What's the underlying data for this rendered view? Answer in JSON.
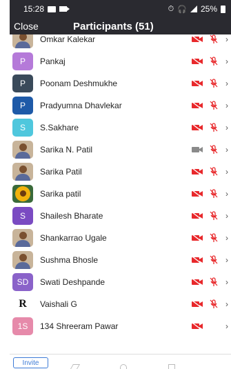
{
  "status_bar": {
    "time": "15:28",
    "battery": "25%"
  },
  "header": {
    "close_label": "Close",
    "title": "Participants (51)"
  },
  "colors": {
    "muted_red": "#e8282b",
    "header_bg": "#2a2a30",
    "video_on_grey": "#8a8a8a"
  },
  "participants": [
    {
      "name": "Omkar Kalekar",
      "avatar": "photo",
      "video": "off",
      "mic": "muted"
    },
    {
      "name": "Pankaj",
      "avatar": "P",
      "avatar_color": "#b57ad9",
      "video": "off",
      "mic": "muted"
    },
    {
      "name": "Poonam Deshmukhe",
      "avatar": "P",
      "avatar_color": "#3a4a5a",
      "video": "off",
      "mic": "muted"
    },
    {
      "name": "Pradyumna Dhavlekar",
      "avatar": "P",
      "avatar_color": "#1e5aa8",
      "video": "off",
      "mic": "muted"
    },
    {
      "name": "S.Sakhare",
      "avatar": "S",
      "avatar_color": "#4fc7dd",
      "video": "off",
      "mic": "muted"
    },
    {
      "name": "Sarika N. Patil",
      "avatar": "photo",
      "video": "on",
      "mic": "muted"
    },
    {
      "name": "Sarika Patil",
      "avatar": "photo",
      "video": "off",
      "mic": "muted"
    },
    {
      "name": "Sarika patil",
      "avatar": "flower",
      "video": "off",
      "mic": "muted"
    },
    {
      "name": "Shailesh Bharate",
      "avatar": "S",
      "avatar_color": "#7a4bc2",
      "video": "off",
      "mic": "muted"
    },
    {
      "name": "Shankarrao Ugale",
      "avatar": "photo",
      "video": "off",
      "mic": "muted"
    },
    {
      "name": "Sushma Bhosle",
      "avatar": "photo",
      "video": "off",
      "mic": "muted"
    },
    {
      "name": "Swati Deshpande",
      "avatar": "SD",
      "avatar_color": "#8a62c9",
      "video": "off",
      "mic": "muted"
    },
    {
      "name": "Vaishali G",
      "avatar": "R",
      "avatar_color": "#ffffff",
      "video": "off",
      "mic": "muted"
    },
    {
      "name": "134 Shreeram Pawar",
      "avatar": "1S",
      "avatar_color": "#e68aaa",
      "video": "off",
      "mic": "none"
    }
  ],
  "footer": {
    "invite_label": "Invite"
  }
}
